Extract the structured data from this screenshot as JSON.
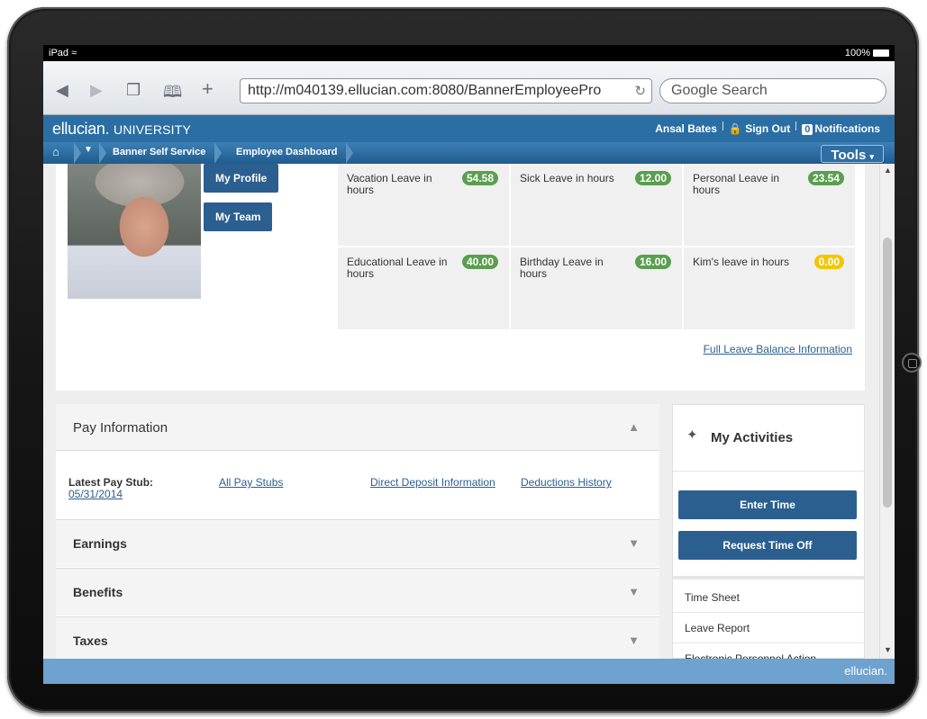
{
  "device": {
    "carrier": "iPad",
    "battery": "100%"
  },
  "browser": {
    "url": "http://m040139.ellucian.com:8080/BannerEmployeePro",
    "search_placeholder": "Google Search"
  },
  "header": {
    "brand": "ellucian.",
    "brand_suffix": "UNIVERSITY",
    "user": "Ansal Bates",
    "sign_out": "Sign Out",
    "notifications_count": "0",
    "notifications_label": "Notifications"
  },
  "breadcrumb": {
    "items": [
      "Banner Self Service",
      "Employee Dashboard"
    ],
    "tools": "Tools"
  },
  "profile": {
    "my_profile": "My Profile",
    "my_team": "My Team"
  },
  "leave": {
    "items": [
      {
        "label": "Vacation Leave in hours",
        "value": "54.58"
      },
      {
        "label": "Sick Leave in hours",
        "value": "12.00"
      },
      {
        "label": "Personal Leave in hours",
        "value": "23.54"
      },
      {
        "label": "Educational Leave in hours",
        "value": "40.00"
      },
      {
        "label": "Birthday Leave in hours",
        "value": "16.00"
      },
      {
        "label": "Kim's leave in hours",
        "value": "0.00"
      }
    ],
    "full_link": "Full Leave Balance Information",
    "badge_color": "#5a9f4f",
    "zero_badge_color": "#f3c600"
  },
  "pay": {
    "title": "Pay Information",
    "latest_label": "Latest Pay Stub:",
    "latest_date": "05/31/2014",
    "links": [
      "All Pay Stubs",
      "Direct Deposit Information",
      "Deductions History"
    ],
    "sections": [
      "Earnings",
      "Benefits",
      "Taxes"
    ]
  },
  "activities": {
    "title": "My Activities",
    "buttons": [
      "Enter Time",
      "Request Time Off"
    ],
    "links": [
      "Time Sheet",
      "Leave Report",
      "Electronic Personnel Action"
    ]
  },
  "footer": {
    "brand": "ellucian."
  },
  "colors": {
    "header_blue": "#2b6ea4",
    "button_blue": "#2b5f8f",
    "footer_blue": "#6ea2cf"
  }
}
